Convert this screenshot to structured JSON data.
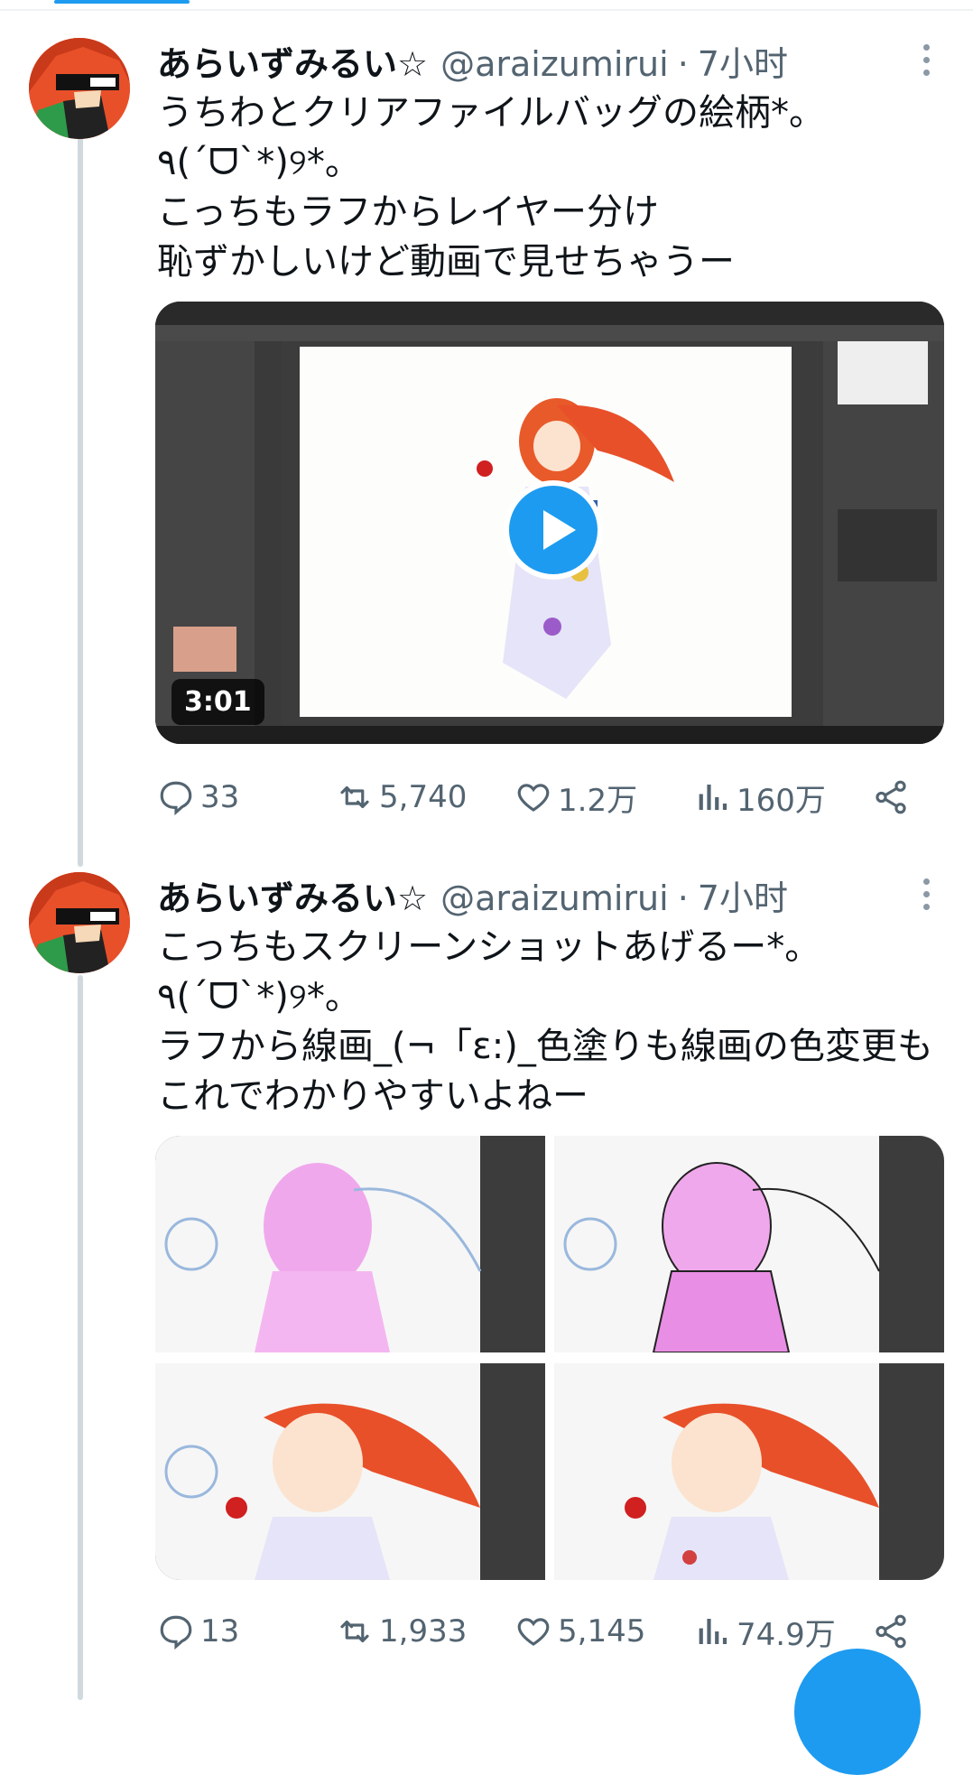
{
  "tweets": [
    {
      "display_name": "あらいずみるい☆",
      "handle": "@araizumirui",
      "separator": "·",
      "time": "7小时",
      "lines": [
        "うちわとクリアファイルバッグの絵柄*。",
        "٩(´ᗜ`*)୨*。",
        "こっちもラフからレイヤー分け",
        "恥ずかしいけど動画で見せちゃうー"
      ],
      "video_duration": "3:01",
      "stats": {
        "replies": "33",
        "retweets": "5,740",
        "likes": "1.2万",
        "views": "160万"
      }
    },
    {
      "display_name": "あらいずみるい☆",
      "handle": "@araizumirui",
      "separator": "·",
      "time": "7小时",
      "lines": [
        "こっちもスクリーンショットあげるー*。",
        "٩(´ᗜ`*)୨*。",
        "ラフから線画_(¬「ε:)_色塗りも線画の色変更も",
        "これでわかりやすいよねー"
      ],
      "stats": {
        "replies": "13",
        "retweets": "1,933",
        "likes": "5,145",
        "views": "74.9万"
      }
    }
  ],
  "icons": [
    "more-icon",
    "reply-icon",
    "retweet-icon",
    "like-icon",
    "views-icon",
    "share-icon",
    "play-icon"
  ],
  "colors": {
    "accent": "#1d9bf0",
    "text": "#0f1419",
    "secondary": "#536471",
    "thread_line": "#cfd9de",
    "hair": "#e8502a"
  }
}
